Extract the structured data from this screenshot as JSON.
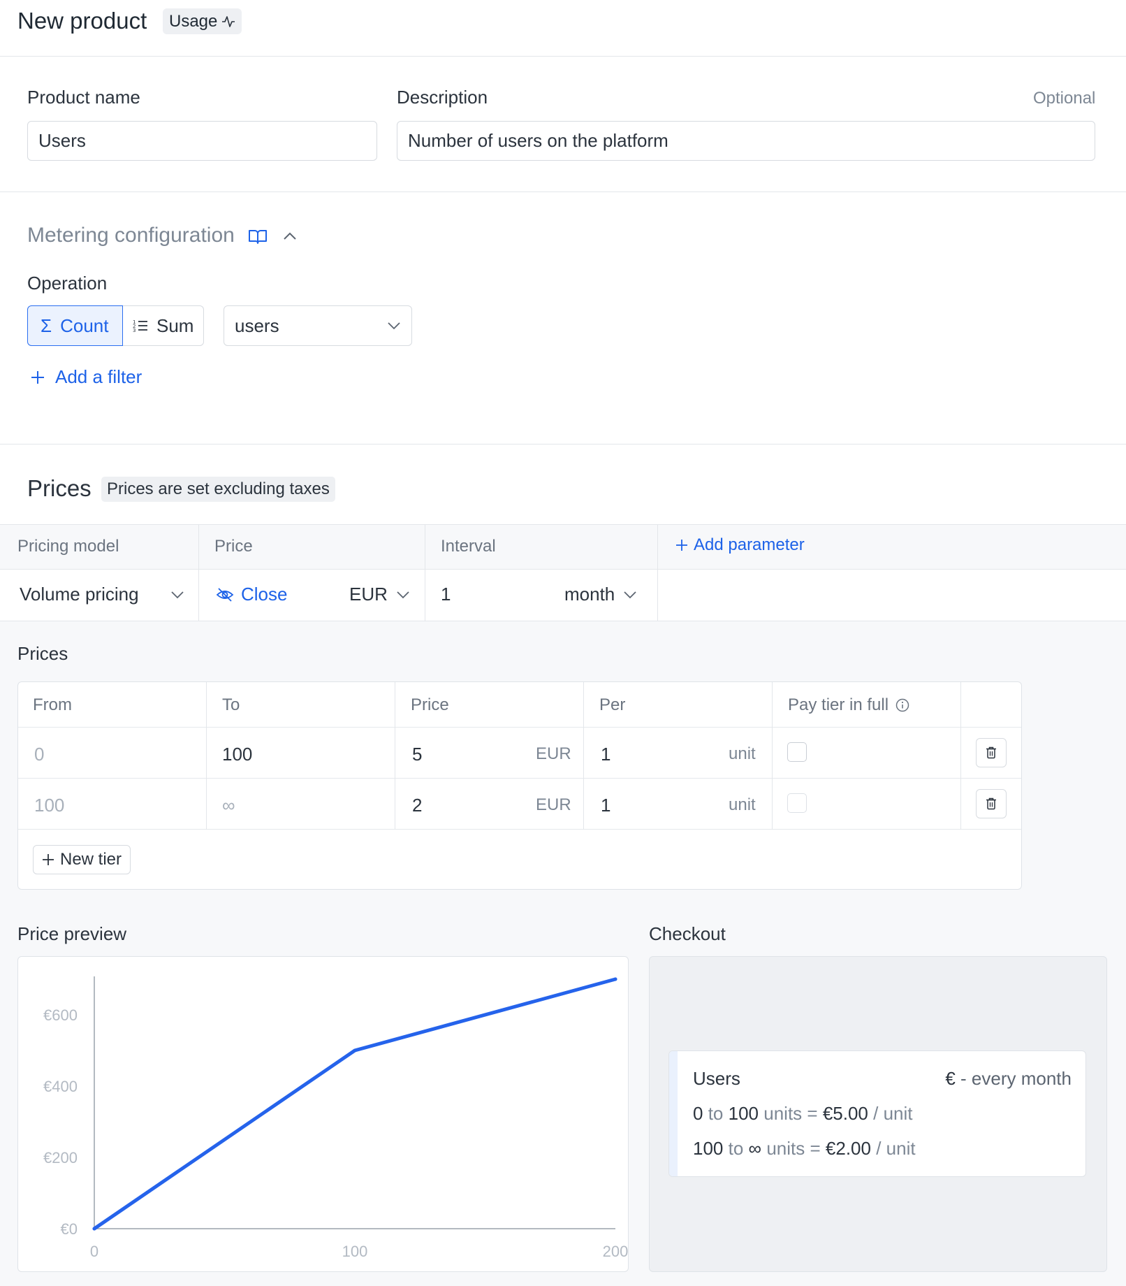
{
  "header": {
    "title": "New product",
    "badge": "Usage"
  },
  "product": {
    "name_label": "Product name",
    "name_value": "Users",
    "description_label": "Description",
    "description_optional": "Optional",
    "description_value": "Number of users on the platform"
  },
  "metering": {
    "title": "Metering configuration",
    "operation_label": "Operation",
    "op_count": "Count",
    "op_sum": "Sum",
    "selected_operation": "Count",
    "event_select": "users",
    "add_filter": "Add a filter"
  },
  "prices": {
    "title": "Prices",
    "tax_note": "Prices are set excluding taxes",
    "columns": {
      "pricing_model": "Pricing model",
      "price": "Price",
      "interval": "Interval",
      "add_parameter": "Add parameter"
    },
    "row": {
      "pricing_model": "Volume pricing",
      "price_toggle": "Close",
      "currency": "EUR",
      "interval_count": "1",
      "interval_unit": "month"
    }
  },
  "tiers": {
    "title": "Prices",
    "headers": {
      "from": "From",
      "to": "To",
      "price": "Price",
      "per": "Per",
      "pay_full": "Pay tier in full"
    },
    "rows": [
      {
        "from": "0",
        "to": "100",
        "price": "5",
        "currency": "EUR",
        "per": "1",
        "unit": "unit",
        "pay_full": false
      },
      {
        "from": "100",
        "to": "∞",
        "price": "2",
        "currency": "EUR",
        "per": "1",
        "unit": "unit",
        "pay_full": false
      }
    ],
    "new_tier": "New tier"
  },
  "preview": {
    "title": "Price preview",
    "y_ticks": [
      "€600",
      "€400",
      "€200",
      "€0"
    ],
    "x_ticks": [
      "0",
      "100",
      "200"
    ]
  },
  "chart_data": {
    "type": "line",
    "title": "",
    "xlabel": "",
    "ylabel": "",
    "x": [
      0,
      100,
      200
    ],
    "series": [
      {
        "values": [
          0,
          500,
          700
        ]
      }
    ],
    "xlim": [
      0,
      200
    ],
    "ylim": [
      0,
      700
    ],
    "y_ticks": [
      0,
      200,
      400,
      600
    ],
    "x_ticks": [
      0,
      100,
      200
    ],
    "grid": false,
    "color": "#2563eb"
  },
  "checkout": {
    "title": "Checkout",
    "product": "Users",
    "currency_symbol": "€",
    "recurrence": "- every month",
    "lines": [
      {
        "from": "0",
        "to_word": "to",
        "to": "100",
        "units": "units",
        "eq": "=",
        "price": "€5.00",
        "per": "/ unit"
      },
      {
        "from": "100",
        "to_word": "to",
        "to": "∞",
        "units": "units",
        "eq": "=",
        "price": "€2.00",
        "per": "/ unit"
      }
    ]
  },
  "colors": {
    "accent": "#1d62e8",
    "line": "#2563eb",
    "border": "#e3e6ea"
  }
}
